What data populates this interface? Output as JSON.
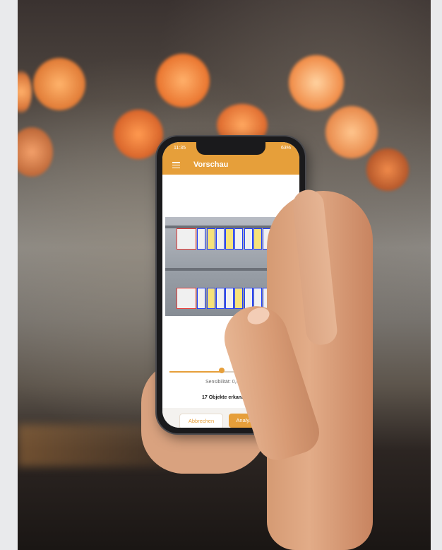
{
  "photo": {
    "description_tag": "hand-holding-smartphone",
    "accent_color": "#e69f3a"
  },
  "phone": {
    "status_bar": {
      "time": "11:35",
      "right": "63%"
    },
    "app_bar": {
      "title": "Vorschau",
      "menu_icon": "hamburger-icon"
    },
    "slider": {
      "value": 0.46,
      "label": "Sensibilität: 0,46"
    },
    "result_text": "17 Objekte erkannt",
    "buttons": {
      "cancel": "Abbrechen",
      "analyze": "Analysieren"
    }
  }
}
